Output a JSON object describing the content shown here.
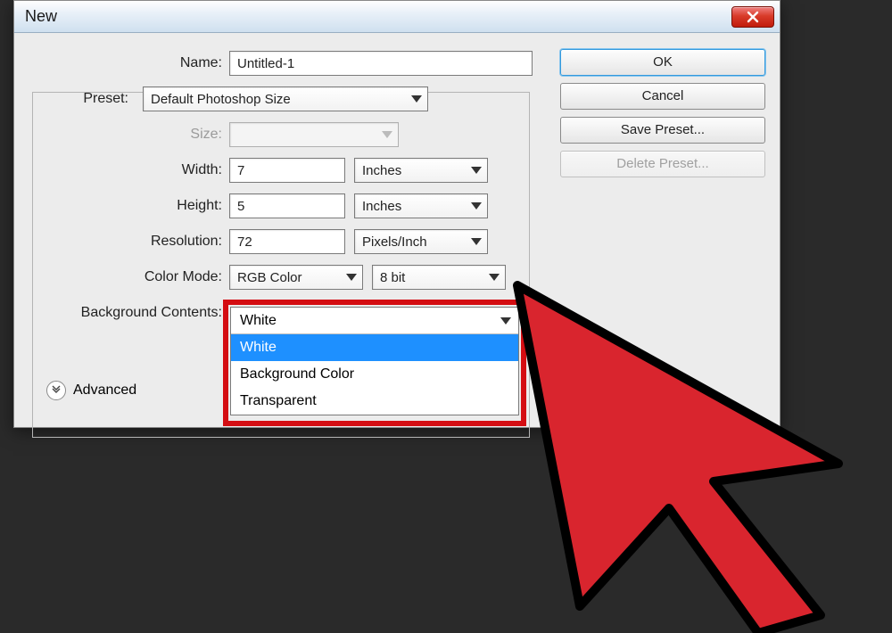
{
  "dialog": {
    "title": "New"
  },
  "fields": {
    "nameLabel": "Name:",
    "nameValue": "Untitled-1",
    "presetLabel": "Preset:",
    "presetValue": "Default Photoshop Size",
    "sizeLabel": "Size:",
    "sizeValue": "",
    "widthLabel": "Width:",
    "widthValue": "7",
    "widthUnit": "Inches",
    "heightLabel": "Height:",
    "heightValue": "5",
    "heightUnit": "Inches",
    "resolutionLabel": "Resolution:",
    "resolutionValue": "72",
    "resolutionUnit": "Pixels/Inch",
    "colorModeLabel": "Color Mode:",
    "colorModeValue": "RGB Color",
    "colorBitValue": "8 bit",
    "bgContentsLabel": "Background Contents:",
    "bgContentsValue": "White",
    "advancedLabel": "Advanced"
  },
  "bgOptions": [
    "White",
    "Background Color",
    "Transparent"
  ],
  "buttons": {
    "ok": "OK",
    "cancel": "Cancel",
    "savePreset": "Save Preset...",
    "deletePreset": "Delete Preset..."
  }
}
